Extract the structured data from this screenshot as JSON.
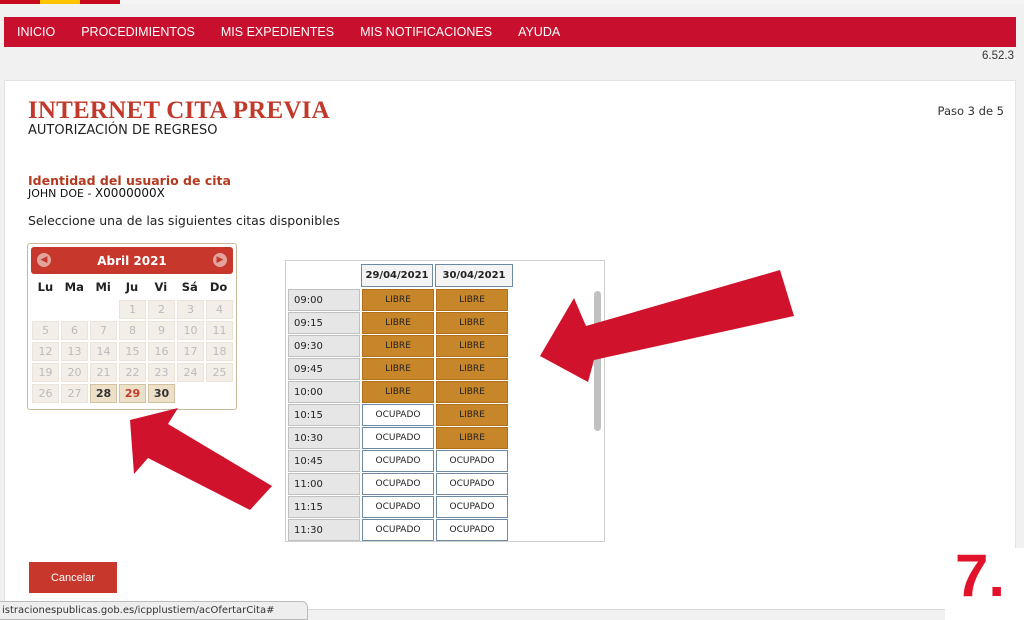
{
  "flag_colors": [
    "#c60b1e",
    "#ffc400",
    "#c60b1e"
  ],
  "nav": {
    "items": [
      "INICIO",
      "PROCEDIMIENTOS",
      "MIS EXPEDIENTES",
      "MIS NOTIFICACIONES",
      "AYUDA"
    ]
  },
  "version": "6.52.3",
  "header": {
    "title": "INTERNET CITA PREVIA",
    "subtitle": "AUTORIZACIÓN DE REGRESO",
    "step": "Paso 3 de 5"
  },
  "identity": {
    "heading": "Identidad del usuario de cita",
    "name": "JOHN DOE",
    "separator": " - ",
    "document": "X0000000X"
  },
  "instruction": "Seleccione una de las siguientes citas disponibles",
  "calendar": {
    "month": "Abril 2021",
    "prev_icon": "chevron-left-icon",
    "next_icon": "chevron-right-icon",
    "weekdays": [
      "Lu",
      "Ma",
      "Mi",
      "Ju",
      "Vi",
      "Sá",
      "Do"
    ],
    "weeks": [
      [
        "",
        "",
        "",
        "1",
        "2",
        "3",
        "4"
      ],
      [
        "5",
        "6",
        "7",
        "8",
        "9",
        "10",
        "11"
      ],
      [
        "12",
        "13",
        "14",
        "15",
        "16",
        "17",
        "18"
      ],
      [
        "19",
        "20",
        "21",
        "22",
        "23",
        "24",
        "25"
      ],
      [
        "26",
        "27",
        "28",
        "29",
        "30",
        "",
        ""
      ]
    ],
    "available": [
      "28",
      "29",
      "30"
    ],
    "selected": "29"
  },
  "slots": {
    "dates": [
      "29/04/2021",
      "30/04/2021"
    ],
    "rows": [
      {
        "time": "09:00",
        "cells": [
          "LIBRE",
          "LIBRE"
        ]
      },
      {
        "time": "09:15",
        "cells": [
          "LIBRE",
          "LIBRE"
        ]
      },
      {
        "time": "09:30",
        "cells": [
          "LIBRE",
          "LIBRE"
        ]
      },
      {
        "time": "09:45",
        "cells": [
          "LIBRE",
          "LIBRE"
        ]
      },
      {
        "time": "10:00",
        "cells": [
          "LIBRE",
          "LIBRE"
        ]
      },
      {
        "time": "10:15",
        "cells": [
          "OCUPADO",
          "LIBRE"
        ]
      },
      {
        "time": "10:30",
        "cells": [
          "OCUPADO",
          "LIBRE"
        ]
      },
      {
        "time": "10:45",
        "cells": [
          "OCUPADO",
          "OCUPADO"
        ]
      },
      {
        "time": "11:00",
        "cells": [
          "OCUPADO",
          "OCUPADO"
        ]
      },
      {
        "time": "11:15",
        "cells": [
          "OCUPADO",
          "OCUPADO"
        ]
      },
      {
        "time": "11:30",
        "cells": [
          "OCUPADO",
          "OCUPADO"
        ]
      }
    ]
  },
  "cancel_label": "Cancelar",
  "status_url": "istracionespublicas.gob.es/icpplustiem/acOfertarCita#",
  "step_badge": "7.",
  "colors": {
    "nav_red": "#c8102e",
    "title_red": "#c0392b",
    "libre": "#c8862a",
    "arrow_red": "#d0122c"
  }
}
